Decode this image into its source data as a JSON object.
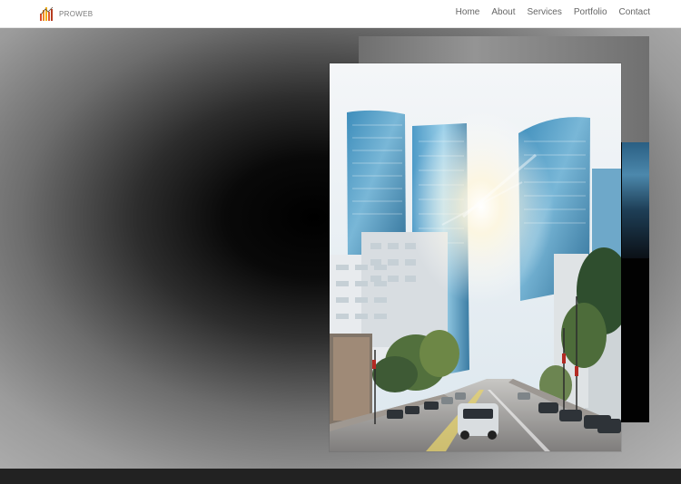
{
  "brand": {
    "name": "PROWEB"
  },
  "nav": {
    "items": [
      "Home",
      "About",
      "Services",
      "Portfolio",
      "Contact"
    ]
  }
}
